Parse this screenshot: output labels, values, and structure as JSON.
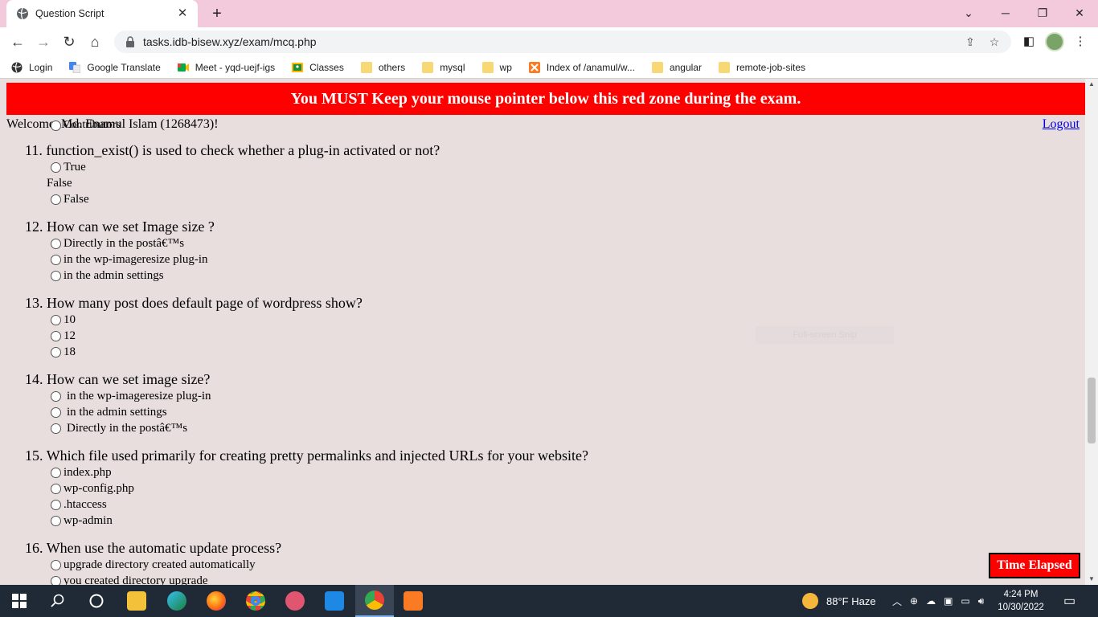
{
  "browser": {
    "tab_title": "Question Script",
    "url": "tasks.idb-bisew.xyz/exam/mcq.php",
    "bookmarks": [
      {
        "label": "Login",
        "icon": "globe-icon"
      },
      {
        "label": "Google Translate",
        "icon": "translate-icon"
      },
      {
        "label": "Meet - yqd-uejf-igs",
        "icon": "meet-icon"
      },
      {
        "label": "Classes",
        "icon": "classroom-icon"
      },
      {
        "label": "others",
        "icon": "folder-icon"
      },
      {
        "label": "mysql",
        "icon": "folder-icon"
      },
      {
        "label": "wp",
        "icon": "folder-icon"
      },
      {
        "label": "Index of /anamul/w...",
        "icon": "xampp-icon"
      },
      {
        "label": "angular",
        "icon": "folder-icon"
      },
      {
        "label": "remote-job-sites",
        "icon": "folder-icon"
      }
    ]
  },
  "page": {
    "red_zone_text": "You MUST Keep your mouse pointer below this red zone during the exam.",
    "welcome_text": "Welcome, Md. Enamul Islam (1268473)!",
    "overlap_text": "Contributors",
    "logout_label": "Logout",
    "snip_text": "Full-screen Snip",
    "timer_label": "Time Elapsed",
    "questions": [
      {
        "number": "11.",
        "text": "function_exist() is used to check whether a plug-in activated or not?",
        "options": [
          {
            "label": "True",
            "radio": true
          },
          {
            "label": "False",
            "radio": false
          },
          {
            "label": "False",
            "radio": true
          }
        ]
      },
      {
        "number": "12.",
        "text": "How can we set Image size ?",
        "options": [
          {
            "label": "Directly in the postâ€™s",
            "radio": true
          },
          {
            "label": "in the wp-imageresize plug-in",
            "radio": true
          },
          {
            "label": "in the admin settings",
            "radio": true
          }
        ]
      },
      {
        "number": "13.",
        "text": "How many post does default page of wordpress show?",
        "options": [
          {
            "label": "10",
            "radio": true
          },
          {
            "label": "12",
            "radio": true
          },
          {
            "label": "18",
            "radio": true
          }
        ]
      },
      {
        "number": "14.",
        "text": "How can we set image size?",
        "options": [
          {
            "label": "in the wp-imageresize plug-in",
            "radio": true
          },
          {
            "label": "in the admin settings",
            "radio": true
          },
          {
            "label": "Directly in the postâ€™s",
            "radio": true
          }
        ]
      },
      {
        "number": "15.",
        "text": "Which file used primarily for creating pretty permalinks and injected URLs for your website?",
        "options": [
          {
            "label": "index.php",
            "radio": true
          },
          {
            "label": "wp-config.php",
            "radio": true
          },
          {
            "label": ".htaccess",
            "radio": true
          },
          {
            "label": "wp-admin",
            "radio": true
          }
        ]
      },
      {
        "number": "16.",
        "text": "When use the automatic update process?",
        "options": [
          {
            "label": "upgrade directory created automatically",
            "radio": true
          },
          {
            "label": "you created directory upgrade",
            "radio": true
          }
        ]
      }
    ]
  },
  "taskbar": {
    "weather": "88°F  Haze",
    "time": "4:24 PM",
    "date": "10/30/2022"
  },
  "colors": {
    "tab_strip": "#f3c9dc",
    "page_bg": "#e8dede",
    "red_zone": "#ff0000",
    "link": "#0000ee",
    "taskbar": "#202a36"
  }
}
